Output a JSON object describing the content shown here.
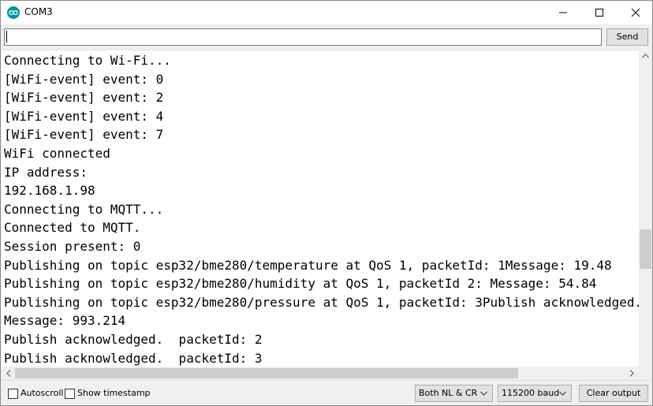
{
  "window": {
    "title": "COM3",
    "app_icon": "arduino-icon"
  },
  "input": {
    "value": "",
    "send_label": "Send"
  },
  "output": {
    "lines": [
      "Connecting to Wi-Fi...",
      "[WiFi-event] event: 0",
      "[WiFi-event] event: 2",
      "[WiFi-event] event: 4",
      "[WiFi-event] event: 7",
      "WiFi connected",
      "IP address:",
      "192.168.1.98",
      "Connecting to MQTT...",
      "Connected to MQTT.",
      "Session present: 0",
      "Publishing on topic esp32/bme280/temperature at QoS 1, packetId: 1Message: 19.48",
      "Publishing on topic esp32/bme280/humidity at QoS 1, packetId 2: Message: 54.84",
      "Publishing on topic esp32/bme280/pressure at QoS 1, packetId: 3Publish acknowledged.",
      "Message: 993.214",
      "Publish acknowledged.  packetId: 2",
      "Publish acknowledged.  packetId: 3"
    ]
  },
  "bottom": {
    "autoscroll_label": "Autoscroll",
    "autoscroll_checked": false,
    "timestamp_label": "Show timestamp",
    "timestamp_checked": false,
    "line_ending": "Both NL & CR",
    "baud": "115200 baud",
    "clear_label": "Clear output"
  }
}
